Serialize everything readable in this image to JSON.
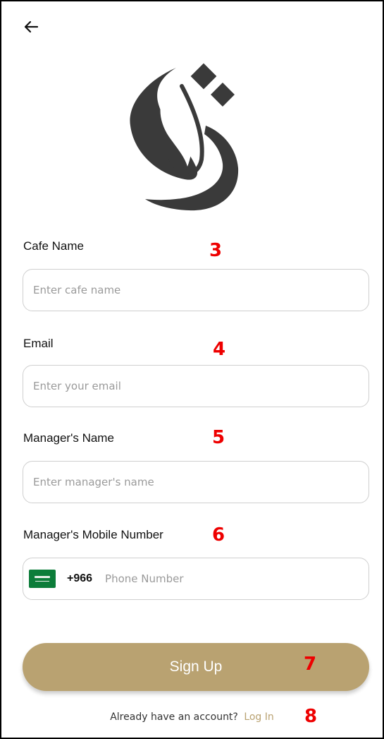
{
  "header": {
    "back_icon": "arrow-left-icon"
  },
  "logo": {
    "icon": "cafe-logo-icon",
    "color": "#3a3a3a"
  },
  "form": {
    "cafe_name": {
      "label": "Cafe Name",
      "placeholder": "Enter cafe name",
      "value": "",
      "step": "3"
    },
    "email": {
      "label": "Email",
      "placeholder": "Enter your email",
      "value": "",
      "step": "4"
    },
    "manager_name": {
      "label": "Manager's Name",
      "placeholder": "Enter manager's name",
      "value": "",
      "step": "5"
    },
    "manager_mobile": {
      "label": "Manager's Mobile Number",
      "flag_icon": "saudi-flag-icon",
      "country_code": "+966",
      "placeholder": "Phone Number",
      "value": "",
      "step": "6"
    }
  },
  "signup": {
    "label": "Sign Up",
    "step": "7",
    "color": "#b9a271"
  },
  "footer": {
    "question": "Already have an account?",
    "link": "Log In",
    "step": "8"
  }
}
